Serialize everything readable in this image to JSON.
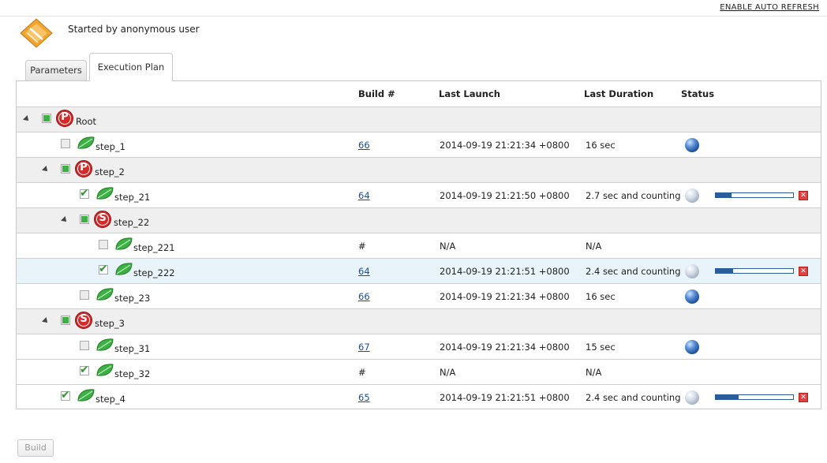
{
  "header": {
    "auto_refresh": "ENABLE AUTO REFRESH",
    "started_by": "Started by anonymous user"
  },
  "tabs": [
    {
      "label": "Parameters",
      "active": false
    },
    {
      "label": "Execution Plan",
      "active": true
    }
  ],
  "columns": {
    "build": "Build #",
    "last_launch": "Last Launch",
    "last_duration": "Last Duration",
    "status": "Status"
  },
  "rows": [
    {
      "name": "Root",
      "type": "P",
      "depth": 0,
      "expandable": true,
      "checkbox": "partial",
      "build": "",
      "launch": "",
      "duration": "",
      "status": "",
      "progress": null
    },
    {
      "name": "step_1",
      "type": "leaf",
      "depth": 1,
      "expandable": false,
      "checkbox": "unchecked",
      "build": "66",
      "launch": "2014-09-19 21:21:34 +0800",
      "duration": "16 sec",
      "status": "blue",
      "progress": null
    },
    {
      "name": "step_2",
      "type": "P",
      "depth": 1,
      "expandable": true,
      "checkbox": "partial",
      "build": "",
      "launch": "",
      "duration": "",
      "status": "",
      "progress": null
    },
    {
      "name": "step_21",
      "type": "leaf",
      "depth": 2,
      "expandable": false,
      "checkbox": "checked",
      "build": "64",
      "launch": "2014-09-19 21:21:50 +0800",
      "duration": "2.7 sec and counting",
      "status": "grey",
      "progress": 0.2
    },
    {
      "name": "step_22",
      "type": "S",
      "depth": 2,
      "expandable": true,
      "checkbox": "partial",
      "build": "",
      "launch": "",
      "duration": "",
      "status": "",
      "progress": null
    },
    {
      "name": "step_221",
      "type": "leaf",
      "depth": 3,
      "expandable": false,
      "checkbox": "unchecked",
      "build": "#",
      "launch": "N/A",
      "duration": "N/A",
      "status": "",
      "progress": null
    },
    {
      "name": "step_222",
      "type": "leaf",
      "depth": 3,
      "expandable": false,
      "checkbox": "checked",
      "build": "64",
      "launch": "2014-09-19 21:21:51 +0800",
      "duration": "2.4 sec and counting",
      "status": "grey",
      "progress": 0.22,
      "selected": true
    },
    {
      "name": "step_23",
      "type": "leaf",
      "depth": 2,
      "expandable": false,
      "checkbox": "unchecked",
      "build": "66",
      "launch": "2014-09-19 21:21:34 +0800",
      "duration": "16 sec",
      "status": "blue",
      "progress": null
    },
    {
      "name": "step_3",
      "type": "S",
      "depth": 1,
      "expandable": true,
      "checkbox": "partial",
      "build": "",
      "launch": "",
      "duration": "",
      "status": "",
      "progress": null
    },
    {
      "name": "step_31",
      "type": "leaf",
      "depth": 2,
      "expandable": false,
      "checkbox": "unchecked",
      "build": "67",
      "launch": "2014-09-19 21:21:34 +0800",
      "duration": "15 sec",
      "status": "blue",
      "progress": null
    },
    {
      "name": "step_32",
      "type": "leaf",
      "depth": 2,
      "expandable": false,
      "checkbox": "checked",
      "build": "#",
      "launch": "N/A",
      "duration": "N/A",
      "status": "",
      "progress": null
    },
    {
      "name": "step_4",
      "type": "leaf",
      "depth": 1,
      "expandable": false,
      "checkbox": "checked",
      "build": "65",
      "launch": "2014-09-19 21:21:51 +0800",
      "duration": "2.4 sec and counting",
      "status": "grey",
      "progress": 0.3
    }
  ],
  "build_button": "Build",
  "colors": {
    "accent_blue": "#2a5d9c",
    "stop_red": "#e04040",
    "badge_red": "#d42a2a",
    "leaf_green": "#3cb043"
  },
  "icons": {
    "logo": "hudson-logo-icon",
    "P": "parallel-badge-icon",
    "S": "sequential-badge-icon",
    "leaf": "leaf-icon",
    "ball_blue": "status-success-ball-icon",
    "ball_grey": "status-running-ball-icon",
    "stop": "stop-icon"
  }
}
